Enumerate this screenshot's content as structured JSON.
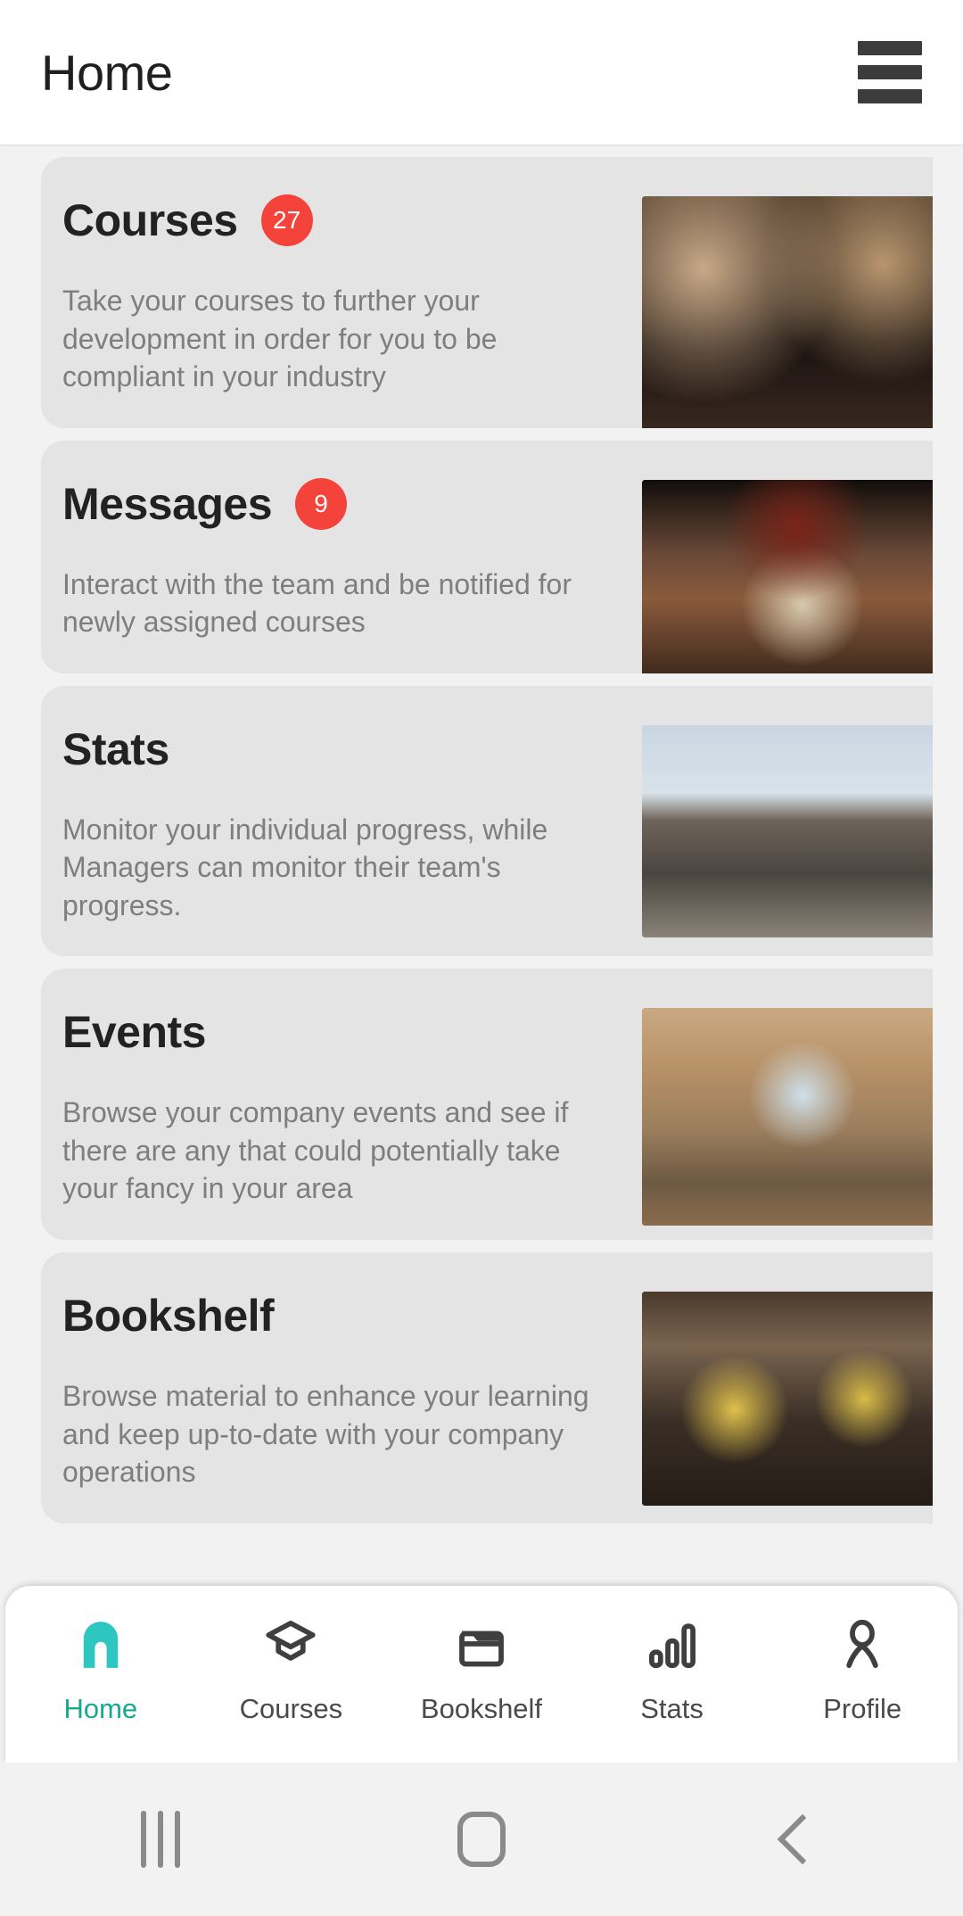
{
  "header": {
    "title": "Home",
    "menu_icon": "hamburger-menu-icon"
  },
  "cards": [
    {
      "title": "Courses",
      "badge": "27",
      "description": "Take your courses to further your development in order for you to be compliant in your industry",
      "photo": "people-toasting-at-restaurant-table"
    },
    {
      "title": "Messages",
      "badge": "9",
      "description": "Interact with the team and be notified for newly assigned courses",
      "photo": "chef-in-apron-preparing-food"
    },
    {
      "title": "Stats",
      "badge": "",
      "description": "Monitor your individual progress, while Managers can monitor their team's progress.",
      "photo": "modern-building-rooftop-terrace"
    },
    {
      "title": "Events",
      "badge": "",
      "description": "Browse your company events and see if there are any that could potentially take your fancy in your area",
      "photo": "arched-window-dining-room-with-plants"
    },
    {
      "title": "Bookshelf",
      "badge": "",
      "description": "Browse material to enhance your learning and keep up-to-date with your company operations",
      "photo": "bar-shelves-with-bottles-and-plants"
    }
  ],
  "bottom_nav": {
    "active": "Home",
    "active_color": "#18a88e",
    "items": [
      {
        "label": "Home",
        "icon": "home-arch-icon"
      },
      {
        "label": "Courses",
        "icon": "graduation-cap-icon"
      },
      {
        "label": "Bookshelf",
        "icon": "folder-icon"
      },
      {
        "label": "Stats",
        "icon": "bar-chart-icon"
      },
      {
        "label": "Profile",
        "icon": "person-icon"
      }
    ]
  },
  "system_bar": {
    "recents_label": "recents-icon",
    "home_label": "home-square-icon",
    "back_label": "back-chevron-icon"
  },
  "colors": {
    "badge": "#f4433b",
    "accent": "#18a88e",
    "card_bg": "#e4e4e4",
    "page_bg": "#f2f2f2"
  }
}
